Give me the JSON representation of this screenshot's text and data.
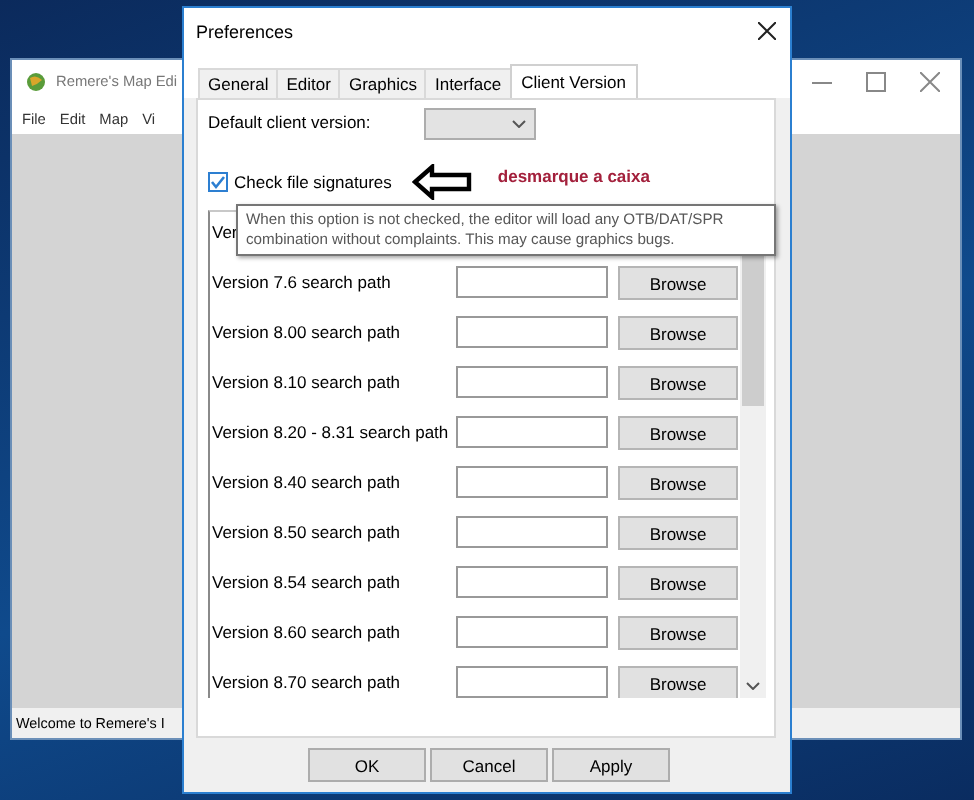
{
  "background_window": {
    "title": "Remere's Map Edi",
    "menu": [
      "File",
      "Edit",
      "Map",
      "Vi"
    ],
    "status_bar": "Welcome to Remere's I"
  },
  "dialog": {
    "title": "Preferences",
    "tabs": [
      {
        "label": "General",
        "selected": false
      },
      {
        "label": "Editor",
        "selected": false
      },
      {
        "label": "Graphics",
        "selected": false
      },
      {
        "label": "Interface",
        "selected": false
      },
      {
        "label": "Client Version",
        "selected": true
      }
    ],
    "default_client_version": {
      "label": "Default client version:"
    },
    "check_signatures": {
      "label": "Check file signatures",
      "checked": true
    },
    "annotation": "desmarque a caixa",
    "tooltip": "When this option is not checked, the editor will load any OTB/DAT/SPR combination without complaints. This may cause graphics bugs.",
    "paths": [
      {
        "label": "Ver"
      },
      {
        "label": "Version 7.6 search path",
        "browse": "Browse"
      },
      {
        "label": "Version 8.00 search path",
        "browse": "Browse"
      },
      {
        "label": "Version 8.10 search path",
        "browse": "Browse"
      },
      {
        "label": "Version 8.20 - 8.31 search path",
        "browse": "Browse"
      },
      {
        "label": "Version 8.40 search path",
        "browse": "Browse"
      },
      {
        "label": "Version 8.50 search path",
        "browse": "Browse"
      },
      {
        "label": "Version 8.54 search path",
        "browse": "Browse"
      },
      {
        "label": "Version 8.60 search path",
        "browse": "Browse"
      },
      {
        "label": "Version 8.70 search path",
        "browse": "Browse"
      }
    ],
    "buttons": [
      "OK",
      "Cancel",
      "Apply"
    ]
  }
}
